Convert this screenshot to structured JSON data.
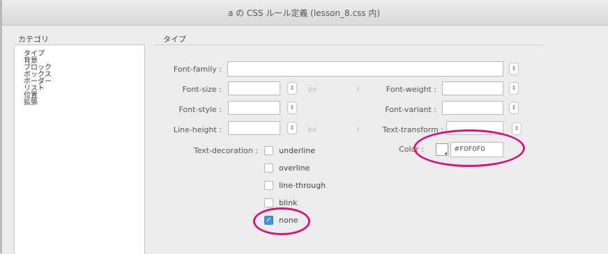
{
  "window": {
    "title": "a の CSS ルール定義 (lesson_8.css 内)"
  },
  "categories": {
    "heading": "カテゴリ",
    "items": [
      "タイプ",
      "背景",
      "ブロック",
      "ボックス",
      "ボーダー",
      "リスト",
      "位置",
      "拡張"
    ],
    "selected_index": 0
  },
  "type_panel": {
    "heading": "タイプ",
    "font_family": {
      "label": "Font-family :",
      "value": ""
    },
    "font_size": {
      "label": "Font-size :",
      "value": "",
      "unit": "px"
    },
    "font_weight": {
      "label": "Font-weight :",
      "value": ""
    },
    "font_style": {
      "label": "Font-style :",
      "value": ""
    },
    "font_variant": {
      "label": "Font-variant :",
      "value": ""
    },
    "line_height": {
      "label": "Line-height :",
      "value": "",
      "unit": "px"
    },
    "text_transform": {
      "label": "Text-transform :",
      "value": ""
    },
    "color": {
      "label": "Color :",
      "value": "#F0F0F0",
      "swatch": "#ffffff"
    },
    "text_decoration": {
      "label": "Text-decoration :",
      "options": [
        {
          "label": "underline",
          "checked": false
        },
        {
          "label": "overline",
          "checked": false
        },
        {
          "label": "line-through",
          "checked": false
        },
        {
          "label": "blink",
          "checked": false
        },
        {
          "label": "none",
          "checked": true
        }
      ]
    }
  },
  "annotation_color": "#d6157a",
  "icons": {
    "stepper": "up-down-arrows-icon",
    "check": "checkmark-icon"
  }
}
